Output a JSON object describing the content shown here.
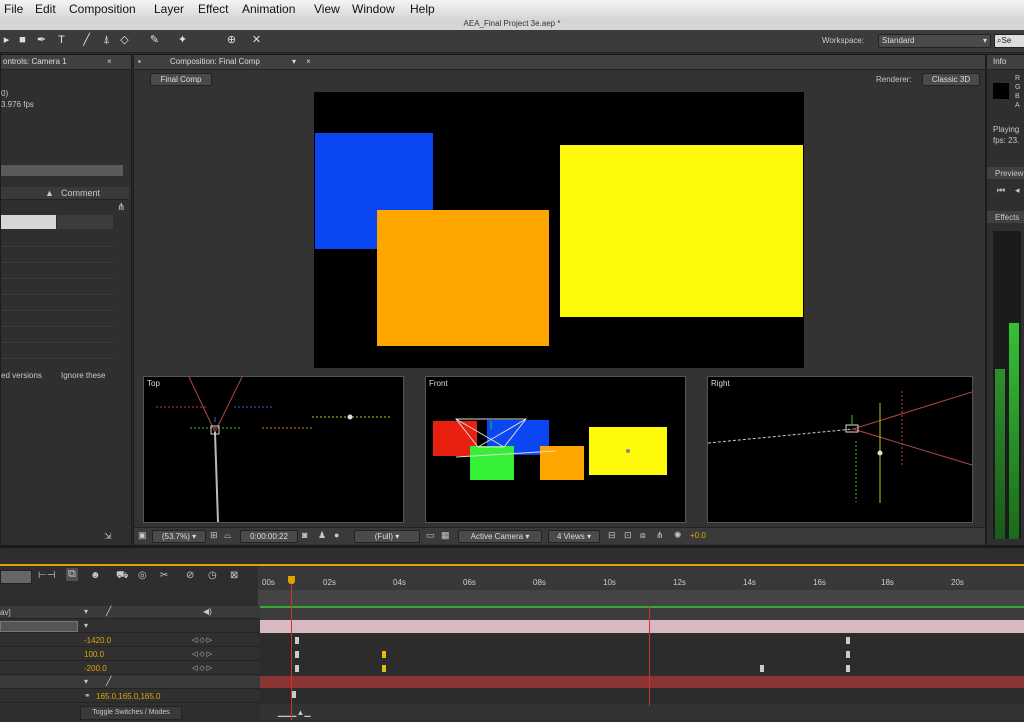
{
  "menu": [
    "File",
    "Edit",
    "Composition",
    "Layer",
    "Effect",
    "Animation",
    "View",
    "Window",
    "Help"
  ],
  "window_title": "AEA_Final Project 3e.aep *",
  "workspace": {
    "label": "Workspace:",
    "value": "Standard",
    "search_placeholder": "Se"
  },
  "left_panel": {
    "tab": "ontrols: Camera 1",
    "line1": "0)",
    "line2": "3.976 fps",
    "comment_header": "Comment",
    "note_left": "ed versions",
    "note_right": "Ignore these"
  },
  "comp_panel": {
    "tab": "Composition: Final Comp",
    "breadcrumb": "Final Comp",
    "renderer_label": "Renderer:",
    "renderer_value": "Classic 3D"
  },
  "views": {
    "top": "Top",
    "front": "Front",
    "right": "Right"
  },
  "viewer_bar": {
    "zoom": "(53.7%)",
    "timecode": "0:00:00:22",
    "resolution": "(Full)",
    "camera": "Active Camera",
    "layout": "4 Views",
    "exposure": "+0.0"
  },
  "right_panel": {
    "info_tab": "Info",
    "rgba": [
      "R",
      "G",
      "B",
      "A"
    ],
    "status1": "Playing",
    "status2": "fps: 23.",
    "preview_tab": "Preview",
    "effects_tab": "Effects"
  },
  "timeline": {
    "ruler": [
      "00s",
      "02s",
      "04s",
      "06s",
      "08s",
      "10s",
      "12s",
      "14s",
      "16s",
      "18s",
      "20s"
    ],
    "layer_name_partial": "av]",
    "values": [
      "-1420.0",
      "100.0",
      "-200.0"
    ],
    "scale_value": "165.0,165.0,165.0",
    "footer": "Toggle Switches / Modes"
  },
  "colors": {
    "blue": "#0a46f2",
    "orange": "#ffa500",
    "yellow": "#fffa0a",
    "red": "#e82010",
    "green": "#36f036",
    "accent": "#e0a400"
  }
}
